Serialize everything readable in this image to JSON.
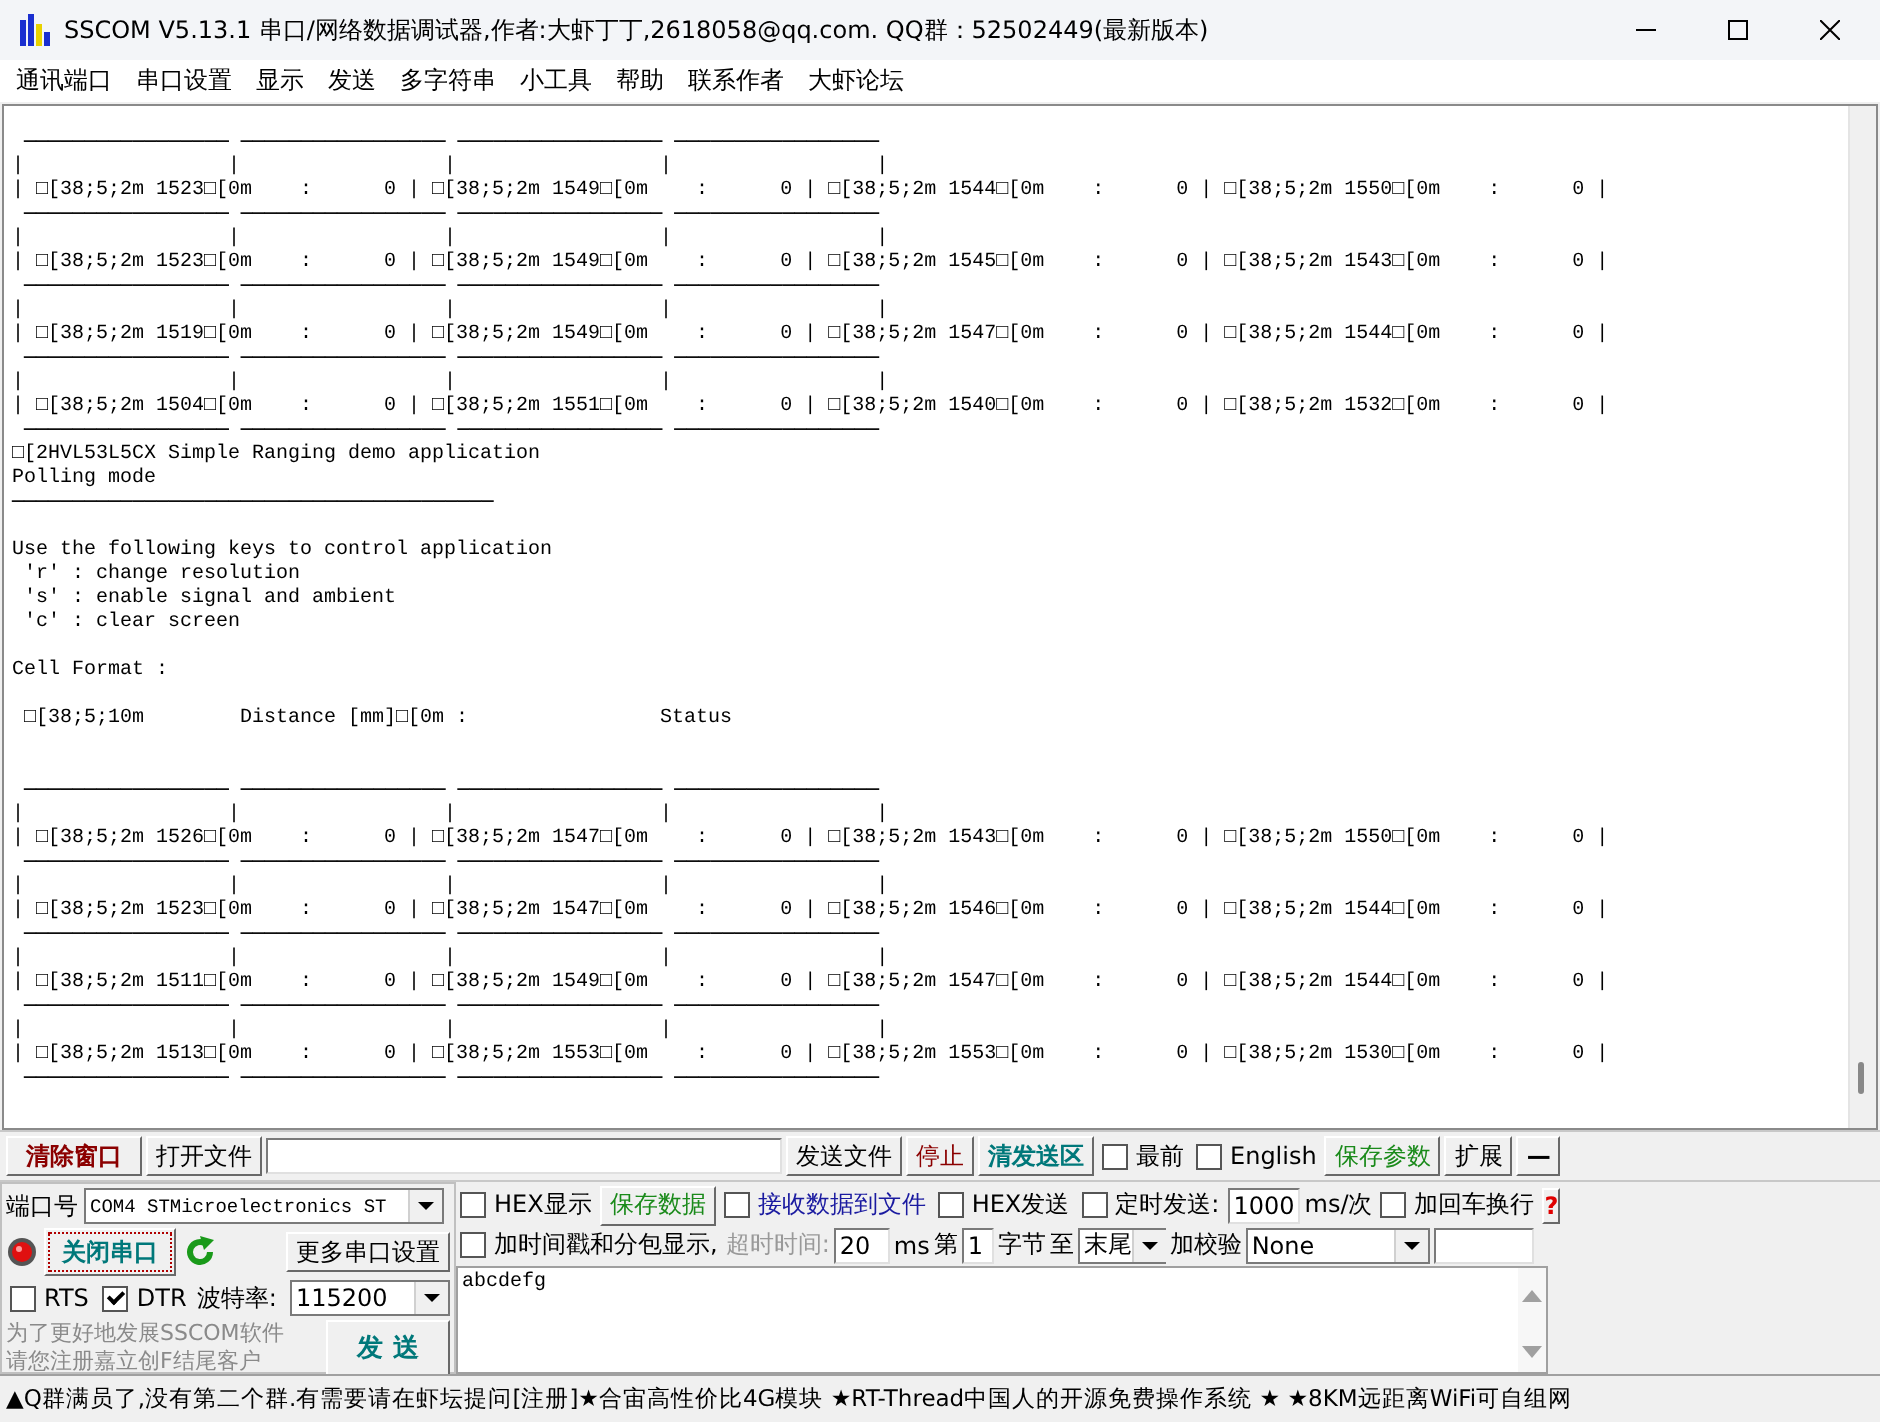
{
  "window": {
    "title": "SSCOM V5.13.1 串口/网络数据调试器,作者:大虾丁丁,2618058@qq.com. QQ群：52502449(最新版本)"
  },
  "menu": [
    {
      "label": "通讯端口"
    },
    {
      "label": "串口设置"
    },
    {
      "label": "显示"
    },
    {
      "label": "发送"
    },
    {
      "label": "多字符串"
    },
    {
      "label": "小工具"
    },
    {
      "label": "帮助"
    },
    {
      "label": "联系作者"
    },
    {
      "label": "大虾论坛"
    }
  ],
  "terminal": {
    "lines": [
      {
        "kind": "blank"
      },
      {
        "kind": "rule",
        "text": " ───────────────── ───────────────── ───────────────── ─────────────────"
      },
      {
        "kind": "bars",
        "text": "|                 |                 |                 |                 |"
      },
      {
        "kind": "text",
        "text": "| □[38;5;2m 1523□[0m    :      0 | □[38;5;2m 1549□[0m    :      0 | □[38;5;2m 1544□[0m    :      0 | □[38;5;2m 1550□[0m    :      0 |"
      },
      {
        "kind": "rule",
        "text": " ───────────────── ───────────────── ───────────────── ─────────────────"
      },
      {
        "kind": "bars",
        "text": "|                 |                 |                 |                 |"
      },
      {
        "kind": "text",
        "text": "| □[38;5;2m 1523□[0m    :      0 | □[38;5;2m 1549□[0m    :      0 | □[38;5;2m 1545□[0m    :      0 | □[38;5;2m 1543□[0m    :      0 |"
      },
      {
        "kind": "rule",
        "text": " ───────────────── ───────────────── ───────────────── ─────────────────"
      },
      {
        "kind": "bars",
        "text": "|                 |                 |                 |                 |"
      },
      {
        "kind": "text",
        "text": "| □[38;5;2m 1519□[0m    :      0 | □[38;5;2m 1549□[0m    :      0 | □[38;5;2m 1547□[0m    :      0 | □[38;5;2m 1544□[0m    :      0 |"
      },
      {
        "kind": "rule",
        "text": " ───────────────── ───────────────── ───────────────── ─────────────────"
      },
      {
        "kind": "bars",
        "text": "|                 |                 |                 |                 |"
      },
      {
        "kind": "text",
        "text": "| □[38;5;2m 1504□[0m    :      0 | □[38;5;2m 1551□[0m    :      0 | □[38;5;2m 1540□[0m    :      0 | □[38;5;2m 1532□[0m    :      0 |"
      },
      {
        "kind": "rule",
        "text": " ───────────────── ───────────────── ───────────────── ─────────────────"
      },
      {
        "kind": "text",
        "text": "□[2HVL53L5CX Simple Ranging demo application"
      },
      {
        "kind": "text",
        "text": "Polling mode"
      },
      {
        "kind": "rule",
        "text": "────────────────────────────────────────"
      },
      {
        "kind": "blank"
      },
      {
        "kind": "text",
        "text": "Use the following keys to control application"
      },
      {
        "kind": "text",
        "text": " 'r' : change resolution"
      },
      {
        "kind": "text",
        "text": " 's' : enable signal and ambient"
      },
      {
        "kind": "text",
        "text": " 'c' : clear screen"
      },
      {
        "kind": "blank"
      },
      {
        "kind": "text",
        "text": "Cell Format :"
      },
      {
        "kind": "blank"
      },
      {
        "kind": "text",
        "text": " □[38;5;10m        Distance [mm]□[0m :                Status"
      },
      {
        "kind": "blank"
      },
      {
        "kind": "blank"
      },
      {
        "kind": "rule",
        "text": " ───────────────── ───────────────── ───────────────── ─────────────────"
      },
      {
        "kind": "bars",
        "text": "|                 |                 |                 |                 |"
      },
      {
        "kind": "text",
        "text": "| □[38;5;2m 1526□[0m    :      0 | □[38;5;2m 1547□[0m    :      0 | □[38;5;2m 1543□[0m    :      0 | □[38;5;2m 1550□[0m    :      0 |"
      },
      {
        "kind": "rule",
        "text": " ───────────────── ───────────────── ───────────────── ─────────────────"
      },
      {
        "kind": "bars",
        "text": "|                 |                 |                 |                 |"
      },
      {
        "kind": "text",
        "text": "| □[38;5;2m 1523□[0m    :      0 | □[38;5;2m 1547□[0m    :      0 | □[38;5;2m 1546□[0m    :      0 | □[38;5;2m 1544□[0m    :      0 |"
      },
      {
        "kind": "rule",
        "text": " ───────────────── ───────────────── ───────────────── ─────────────────"
      },
      {
        "kind": "bars",
        "text": "|                 |                 |                 |                 |"
      },
      {
        "kind": "text",
        "text": "| □[38;5;2m 1511□[0m    :      0 | □[38;5;2m 1549□[0m    :      0 | □[38;5;2m 1547□[0m    :      0 | □[38;5;2m 1544□[0m    :      0 |"
      },
      {
        "kind": "rule",
        "text": " ───────────────── ───────────────── ───────────────── ─────────────────"
      },
      {
        "kind": "bars",
        "text": "|                 |                 |                 |                 |"
      },
      {
        "kind": "text",
        "text": "| □[38;5;2m 1513□[0m    :      0 | □[38;5;2m 1553□[0m    :      0 | □[38;5;2m 1553□[0m    :      0 | □[38;5;2m 1530□[0m    :      0 |"
      },
      {
        "kind": "rule",
        "text": " ───────────────── ───────────────── ───────────────── ─────────────────"
      }
    ]
  },
  "toolbar": {
    "clear_button": "清除窗口",
    "open_file_button": "打开文件",
    "send_file_button": "发送文件",
    "stop_button": "停止",
    "clear_send_button": "清发送区",
    "topmost": {
      "label": "最前",
      "checked": false
    },
    "english": {
      "label": "English",
      "checked": false
    },
    "save_params_button": "保存参数",
    "expand_button": "扩展",
    "collapse_button": "—"
  },
  "port": {
    "label": "端口号",
    "value": "COM4 STMicroelectronics ST",
    "close_button": "关闭串口",
    "more_settings_button": "更多串口设置",
    "rts": {
      "label": "RTS",
      "checked": false
    },
    "dtr": {
      "label": "DTR",
      "checked": true
    },
    "baud_label": "波特率:",
    "baud_value": "115200",
    "promo": [
      "为了更好地发展SSCOM软件",
      "请您注册嘉立创F结尾客户"
    ],
    "send_button": "发 送"
  },
  "options": {
    "hex_display": {
      "label": "HEX显示",
      "checked": false
    },
    "save_data_button": "保存数据",
    "receive_to_file": {
      "label": "接收数据到文件",
      "checked": false
    },
    "hex_send": {
      "label": "HEX发送",
      "checked": false
    },
    "timed_send": {
      "label": "定时发送:",
      "checked": false
    },
    "interval": "1000",
    "interval_unit": "ms/次",
    "append_newline": {
      "label": "加回车换行",
      "checked": false
    },
    "help": "?",
    "timestamp": {
      "label": "加时间戳和分包显示,",
      "checked": false
    },
    "timeout_label": "超时时间:",
    "timeout": "20",
    "timeout_unit": "ms",
    "from_label": "第",
    "from": "1",
    "bytes_label": "字节",
    "to_label": "至",
    "to": "末尾",
    "checksum_label": "加校验",
    "checksum": "None"
  },
  "send_text": "abcdefg",
  "status_bar": "▲Q群满员了,没有第二个群.有需要请在虾坛提问[注册]★合宙高性价比4G模块 ★RT-Thread中国人的开源免费操作系统 ★ ★8KM远距离WiFi可自组网"
}
